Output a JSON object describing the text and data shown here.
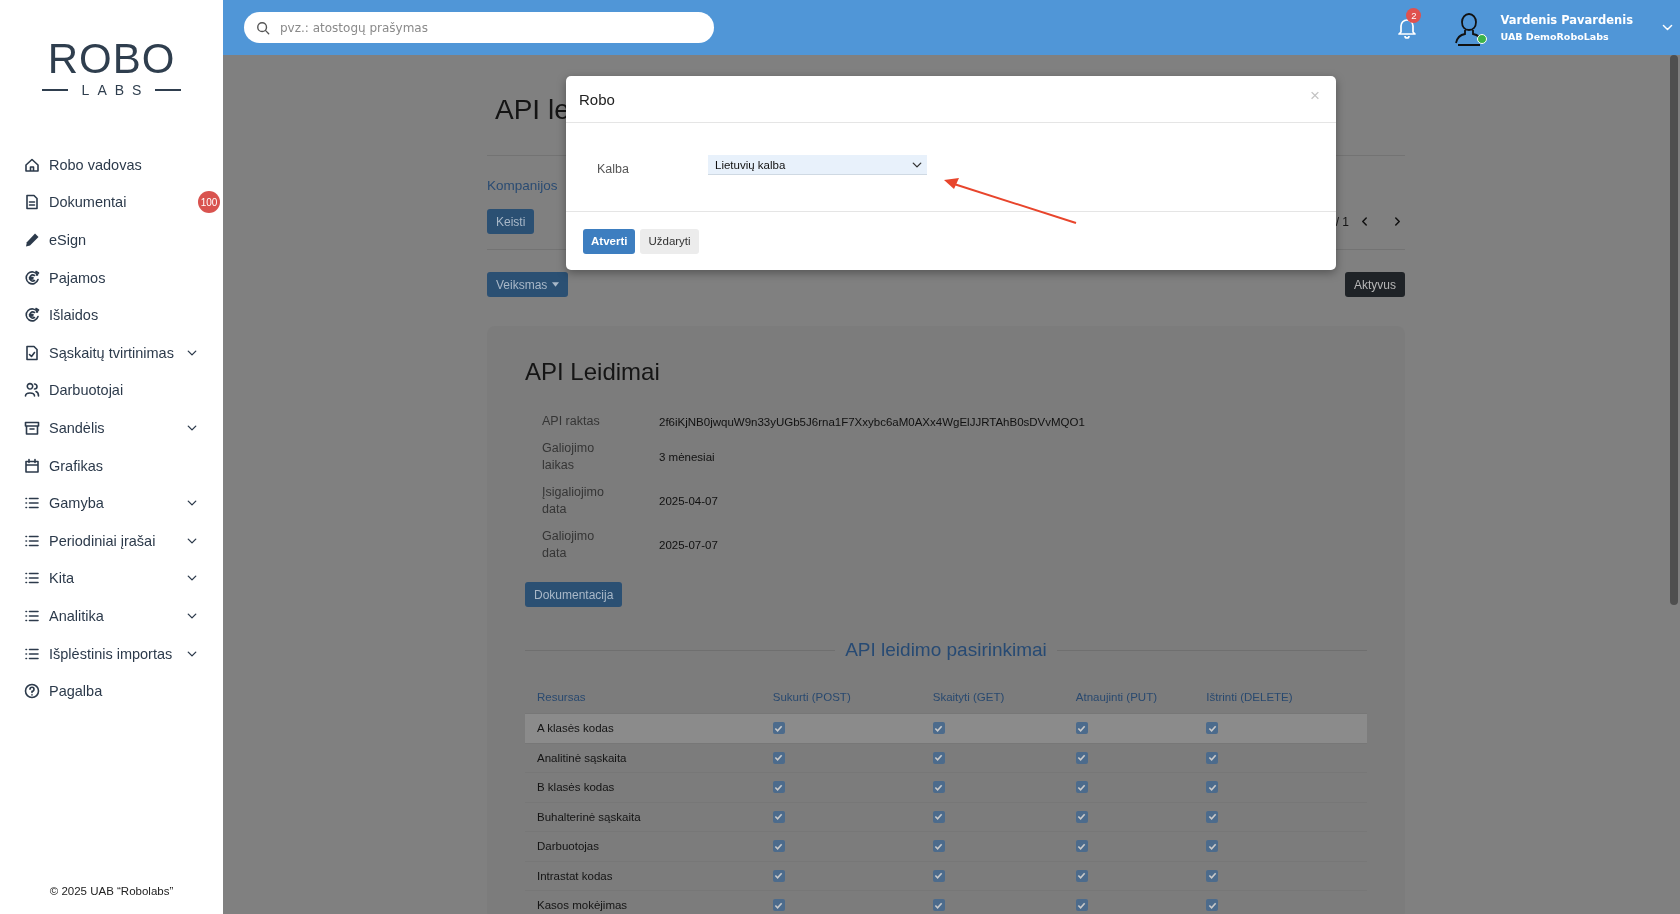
{
  "sidebar": {
    "logo": {
      "word": "ROBO",
      "sub": "LABS"
    },
    "items": [
      {
        "label": "Robo vadovas",
        "expandable": false
      },
      {
        "label": "Dokumentai",
        "expandable": false,
        "badge": "100"
      },
      {
        "label": "eSign",
        "expandable": false
      },
      {
        "label": "Pajamos",
        "expandable": false
      },
      {
        "label": "Išlaidos",
        "expandable": false
      },
      {
        "label": "Sąskaitų tvirtinimas",
        "expandable": true
      },
      {
        "label": "Darbuotojai",
        "expandable": false
      },
      {
        "label": "Sandėlis",
        "expandable": true
      },
      {
        "label": "Grafikas",
        "expandable": false
      },
      {
        "label": "Gamyba",
        "expandable": true
      },
      {
        "label": "Periodiniai įrašai",
        "expandable": true
      },
      {
        "label": "Kita",
        "expandable": true
      },
      {
        "label": "Analitika",
        "expandable": true
      },
      {
        "label": "Išplėstinis importas",
        "expandable": true
      },
      {
        "label": "Pagalba",
        "expandable": false
      }
    ],
    "footer": "© 2025 UAB “Robolabs”"
  },
  "topbar": {
    "search": {
      "placeholder": "pvz.: atostogų prašymas"
    },
    "notifications": "2",
    "user": {
      "name": "Vardenis Pavardenis",
      "company": "UAB DemoRoboLabs",
      "online": true
    }
  },
  "page": {
    "title": "API le",
    "link": "Kompanijos",
    "edit_button": "Keisti",
    "pager": "/ 1",
    "action_button": "Veiksmas",
    "status_button": "Aktyvus",
    "card": {
      "title": "API Leidimai",
      "fields": [
        {
          "label": "API raktas",
          "value": "2f6iKjNB0jwquW9n33yUGb5J6rna1F7Xxybc6aM0AXx4WgElJJRTAhB0sDVvMQO1"
        },
        {
          "label": "Galiojimo laikas",
          "value": "3 mėnesiai"
        },
        {
          "label": "Įsigaliojimo data",
          "value": "2025-04-07"
        },
        {
          "label": "Galiojimo data",
          "value": "2025-07-07"
        }
      ],
      "doc_button": "Dokumentacija",
      "section_title": "API leidimo pasirinkimai",
      "table": {
        "columns": [
          "Resursas",
          "Sukurti (POST)",
          "Skaityti (GET)",
          "Atnaujinti (PUT)",
          "Ištrinti (DELETE)"
        ],
        "rows": [
          {
            "name": "A klasės kodas",
            "highlighted": true,
            "checks": [
              true,
              true,
              true,
              true
            ]
          },
          {
            "name": "Analitinė sąskaita",
            "highlighted": false,
            "checks": [
              true,
              true,
              true,
              true
            ]
          },
          {
            "name": "B klasės kodas",
            "highlighted": false,
            "checks": [
              true,
              true,
              true,
              true
            ]
          },
          {
            "name": "Buhalterinė sąskaita",
            "highlighted": false,
            "checks": [
              true,
              true,
              true,
              true
            ]
          },
          {
            "name": "Darbuotojas",
            "highlighted": false,
            "checks": [
              true,
              true,
              true,
              true
            ]
          },
          {
            "name": "Intrastat kodas",
            "highlighted": false,
            "checks": [
              true,
              true,
              true,
              true
            ]
          },
          {
            "name": "Kasos mokėjimas",
            "highlighted": false,
            "checks": [
              true,
              true,
              true,
              true
            ]
          }
        ]
      }
    }
  },
  "modal": {
    "title": "Robo",
    "close": "×",
    "field_label": "Kalba",
    "select_value": "Lietuvių kalba",
    "buttons": [
      {
        "label": "Atverti",
        "kind": "primary"
      },
      {
        "label": "Uždaryti",
        "kind": "secondary"
      }
    ]
  }
}
